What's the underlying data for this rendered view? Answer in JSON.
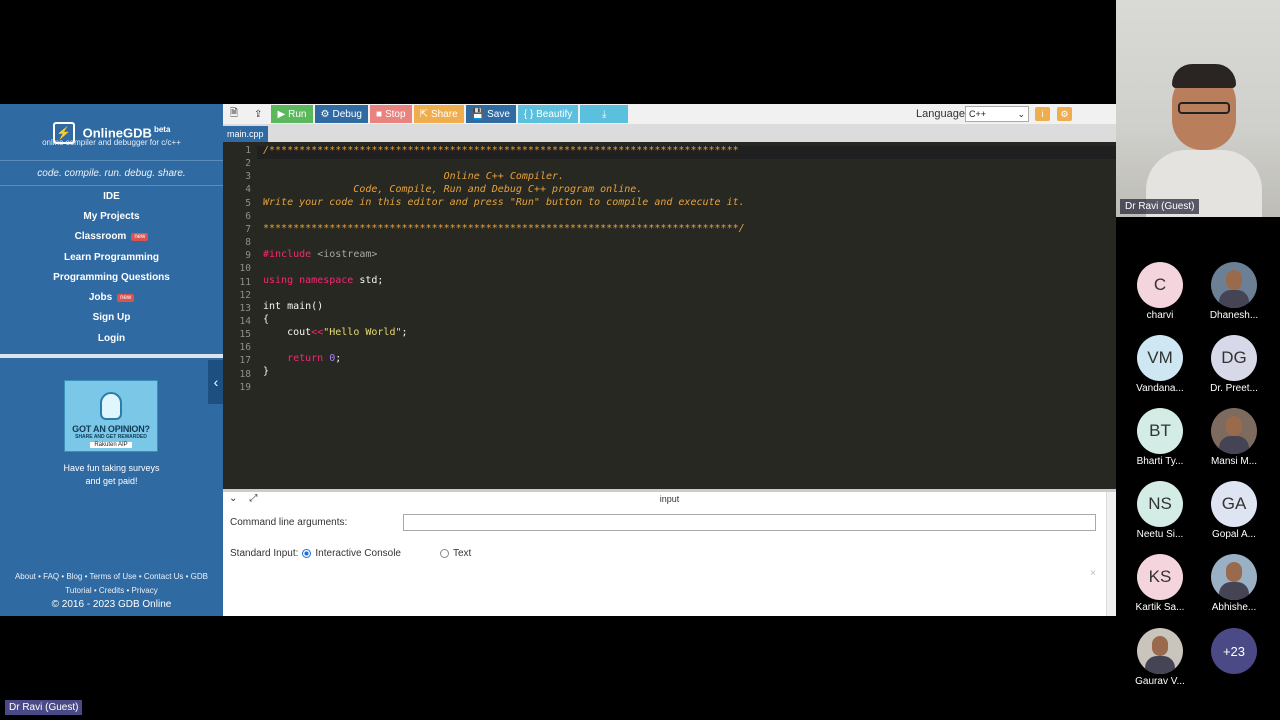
{
  "brand": {
    "name": "OnlineGDB",
    "sup": "beta",
    "tagline": "online compiler and debugger for c/c++",
    "slogan": "code. compile. run. debug. share."
  },
  "nav": [
    {
      "label": "IDE",
      "badge": ""
    },
    {
      "label": "My Projects",
      "badge": ""
    },
    {
      "label": "Classroom",
      "badge": "new"
    },
    {
      "label": "Learn Programming",
      "badge": ""
    },
    {
      "label": "Programming Questions",
      "badge": ""
    },
    {
      "label": "Jobs",
      "badge": "new"
    },
    {
      "label": "Sign Up",
      "badge": ""
    },
    {
      "label": "Login",
      "badge": ""
    }
  ],
  "ad": {
    "title": "GOT AN OPINION?",
    "sub": "SHARE AND GET REWARDED",
    "brand": "Rakuten AIP",
    "text1": "Have fun taking surveys",
    "text2": "and get paid!"
  },
  "footer": {
    "line1": "About • FAQ • Blog • Terms of Use • Contact Us • GDB",
    "line2": "Tutorial • Credits • Privacy",
    "copy": "© 2016 - 2023 GDB Online"
  },
  "toolbar": {
    "run": "Run",
    "debug": "Debug",
    "stop": "Stop",
    "share": "Share",
    "save": "Save",
    "beautify": "{ } Beautify",
    "language_label": "Language",
    "language_value": "C++",
    "colors": {
      "run": "#5cb85c",
      "debug": "#2f6aa3",
      "stop": "#d9534f",
      "share": "#f0ad4e",
      "save": "#2f6aa3",
      "beautify": "#5bc0de",
      "download": "#5bc0de"
    }
  },
  "file_tab": "main.cpp",
  "code": {
    "line_numbers": [
      "1",
      "2",
      "3",
      "4",
      "5",
      "6",
      "7",
      "8",
      "9",
      "10",
      "11",
      "12",
      "13",
      "14",
      "15",
      "16",
      "17",
      "18",
      "19"
    ],
    "l1": "/******************************************************************************",
    "l3": "                              Online C++ Compiler.",
    "l4": "               Code, Compile, Run and Debug C++ program online.",
    "l5": "Write your code in this editor and press \"Run\" button to compile and execute it.",
    "l7": "*******************************************************************************/",
    "l9_a": "#include",
    "l9_b": " <iostream>",
    "l11_a": "using",
    "l11_b": " namespace",
    "l11_c": " std;",
    "l13": "int main()",
    "l14": "{",
    "l15_a": "    cout",
    "l15_b": "<<",
    "l15_c": "\"Hello World\"",
    "l15_d": ";",
    "l17_a": "    return",
    "l17_b": " 0",
    "l17_c": ";",
    "l18": "}"
  },
  "input_panel": {
    "title": "input",
    "cla_label": "Command line arguments:",
    "stdin_label": "Standard Input:",
    "opt_console": "Interactive Console",
    "opt_text": "Text"
  },
  "meeting": {
    "speaker_label": "Dr Ravi (Guest)",
    "participants": [
      {
        "initials": "C",
        "name": "charvi",
        "color": "#f4d4dd"
      },
      {
        "initials": "",
        "name": "Dhanesh...",
        "color": "#6b7f95"
      },
      {
        "initials": "VM",
        "name": "Vandana...",
        "color": "#cfe6f3"
      },
      {
        "initials": "DG",
        "name": "Dr. Preet...",
        "color": "#d8d9e8"
      },
      {
        "initials": "BT",
        "name": "Bharti Ty...",
        "color": "#d3ece6"
      },
      {
        "initials": "",
        "name": "Mansi M...",
        "color": "#7d6b5f"
      },
      {
        "initials": "NS",
        "name": "Neetu Si...",
        "color": "#d3ece6"
      },
      {
        "initials": "GA",
        "name": "Gopal A...",
        "color": "#dfe4f3"
      },
      {
        "initials": "KS",
        "name": "Kartik Sa...",
        "color": "#f4d4dd"
      },
      {
        "initials": "",
        "name": "Abhishe...",
        "color": "#9ab0c4"
      },
      {
        "initials": "",
        "name": "Gaurav V...",
        "color": "#c9c5bc"
      },
      {
        "initials": "+23",
        "name": "",
        "color": "#4c4a86"
      }
    ],
    "bottom_label": "Dr Ravi (Guest)"
  }
}
